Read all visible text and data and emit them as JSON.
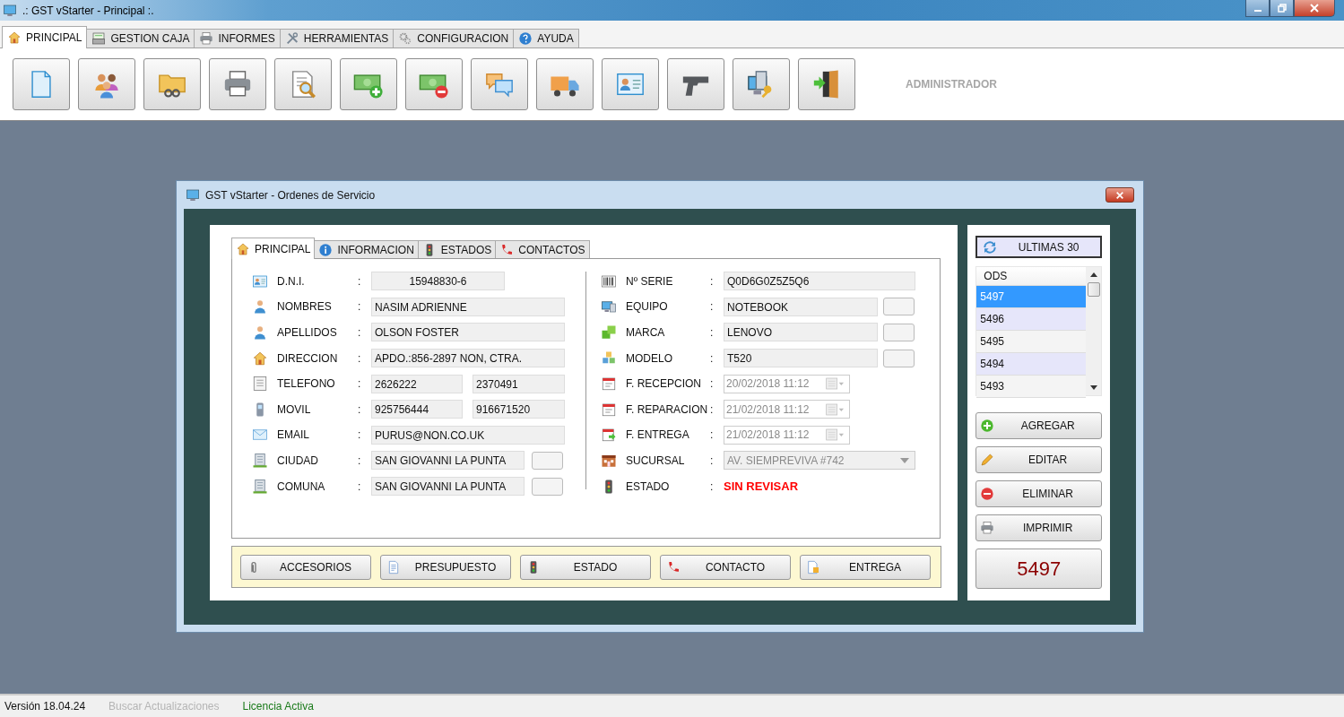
{
  "window": {
    "title": ".: GST vStarter - Principal :."
  },
  "menu_tabs": [
    {
      "label": "PRINCIPAL",
      "selected": true
    },
    {
      "label": "GESTION CAJA",
      "selected": false
    },
    {
      "label": "INFORMES",
      "selected": false
    },
    {
      "label": "HERRAMIENTAS",
      "selected": false
    },
    {
      "label": "CONFIGURACION",
      "selected": false
    },
    {
      "label": "AYUDA",
      "selected": false
    }
  ],
  "toolbar": {
    "user": "ADMINISTRADOR"
  },
  "service_window": {
    "title": "GST vStarter - Ordenes de Servicio"
  },
  "form_tabs": [
    {
      "label": "PRINCIPAL",
      "selected": true
    },
    {
      "label": "INFORMACION",
      "selected": false
    },
    {
      "label": "ESTADOS",
      "selected": false
    },
    {
      "label": "CONTACTOS",
      "selected": false
    }
  ],
  "client_fields": [
    {
      "label": "D.N.I.",
      "colon": ":",
      "kind": "centered",
      "values": [
        "15948830-6"
      ]
    },
    {
      "label": "NOMBRES",
      "colon": ":",
      "kind": "text",
      "values": [
        "NASIM ADRIENNE"
      ]
    },
    {
      "label": "APELLIDOS",
      "colon": ":",
      "kind": "text",
      "values": [
        "OLSON FOSTER"
      ]
    },
    {
      "label": "DIRECCION",
      "colon": ":",
      "kind": "text",
      "values": [
        "APDO.:856-2897 NON, CTRA."
      ]
    },
    {
      "label": "TELEFONO",
      "colon": ":",
      "kind": "pair",
      "values": [
        "2626222",
        "2370491"
      ]
    },
    {
      "label": "MOVIL",
      "colon": ":",
      "kind": "pair",
      "values": [
        "925756444",
        "916671520"
      ]
    },
    {
      "label": "EMAIL",
      "colon": ":",
      "kind": "text",
      "values": [
        "PURUS@NON.CO.UK"
      ]
    },
    {
      "label": "CIUDAD",
      "colon": ":",
      "kind": "text_button",
      "values": [
        "SAN GIOVANNI LA PUNTA"
      ]
    },
    {
      "label": "COMUNA",
      "colon": ":",
      "kind": "text_button",
      "values": [
        "SAN GIOVANNI LA PUNTA"
      ]
    }
  ],
  "equipment_fields": [
    {
      "label": "Nº SERIE",
      "colon": ":",
      "kind": "text",
      "value": "Q0D6G0Z5Z5Q6",
      "disabled": false
    },
    {
      "label": "EQUIPO",
      "colon": ":",
      "kind": "text_button",
      "value": "NOTEBOOK",
      "disabled": false
    },
    {
      "label": "MARCA",
      "colon": ":",
      "kind": "text_button",
      "value": "LENOVO",
      "disabled": false
    },
    {
      "label": "MODELO",
      "colon": ":",
      "kind": "text_button",
      "value": "T520",
      "disabled": false
    },
    {
      "label": "F. RECEPCION",
      "colon": ":",
      "kind": "date",
      "value": "20/02/2018 11:12",
      "disabled": true
    },
    {
      "label": "F. REPARACION",
      "colon": ":",
      "kind": "date",
      "value": "21/02/2018 11:12",
      "disabled": true
    },
    {
      "label": "F. ENTREGA",
      "colon": ":",
      "kind": "date",
      "value": "21/02/2018 11:12",
      "disabled": true
    },
    {
      "label": "SUCURSAL",
      "colon": ":",
      "kind": "combo",
      "value": "AV. SIEMPREVIVA #742",
      "disabled": true
    },
    {
      "label": "ESTADO",
      "colon": ":",
      "kind": "status",
      "value": "SIN REVISAR",
      "disabled": false
    }
  ],
  "action_buttons": [
    "ACCESORIOS",
    "PRESUPUESTO",
    "ESTADO",
    "CONTACTO",
    "ENTREGA"
  ],
  "recent": {
    "title": "ULTIMAS 30",
    "column": "ODS",
    "rows": [
      {
        "value": "5497",
        "selected": true
      },
      {
        "value": "5496",
        "selected": false
      },
      {
        "value": "5495",
        "selected": false
      },
      {
        "value": "5494",
        "selected": false
      },
      {
        "value": "5493",
        "selected": false
      }
    ]
  },
  "side_buttons": [
    "AGREGAR",
    "EDITAR",
    "ELIMINAR",
    "IMPRIMIR"
  ],
  "current_order": "5497",
  "status_bar": [
    {
      "text": "Versión 18.04.24",
      "kind": "normal"
    },
    {
      "text": "Buscar Actualizaciones",
      "kind": "disabled"
    },
    {
      "text": "Licencia Activa",
      "kind": "ok"
    }
  ]
}
